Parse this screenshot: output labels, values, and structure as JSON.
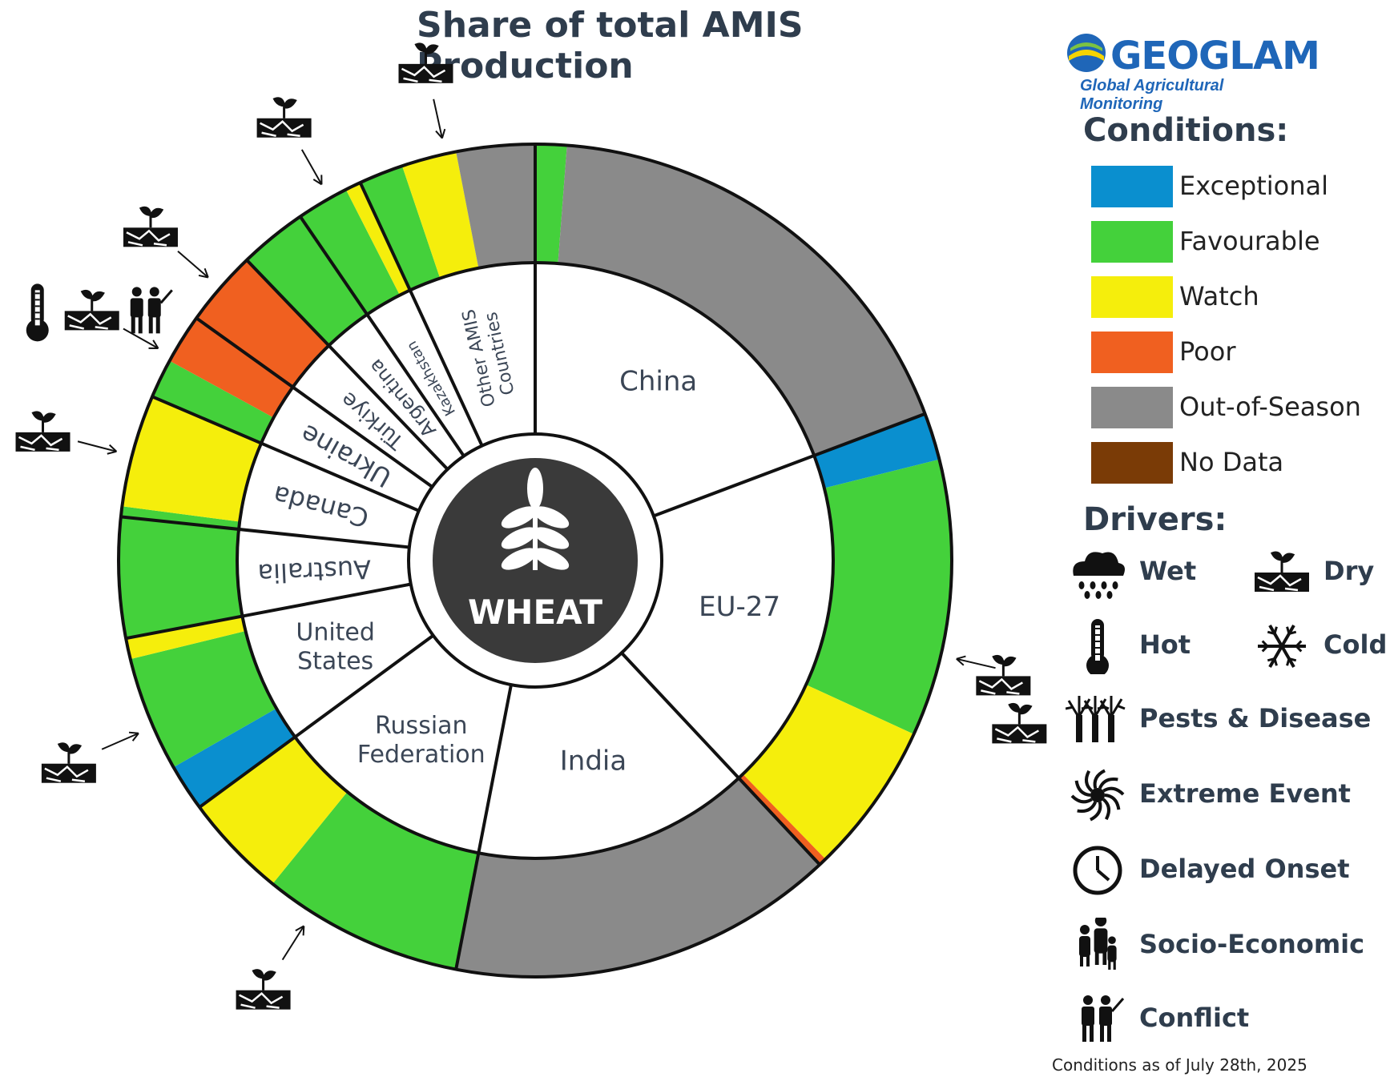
{
  "title": "Share of total AMIS Production",
  "crop": "WHEAT",
  "footnote": "Conditions as of July 28th, 2025",
  "logo": {
    "name": "GEOGLAM",
    "tagline": "Global Agricultural Monitoring"
  },
  "colors": {
    "Exceptional": "#0a8fcf",
    "Favourable": "#44d13b",
    "Watch": "#f5ee0c",
    "Poor": "#f06020",
    "Out-of-Season": "#8a8a8a",
    "No Data": "#7a3b06",
    "center": "#3a3a3a"
  },
  "legend": {
    "conditions_title": "Conditions:",
    "conditions": [
      {
        "label": "Exceptional",
        "key": "Exceptional"
      },
      {
        "label": "Favourable",
        "key": "Favourable"
      },
      {
        "label": "Watch",
        "key": "Watch"
      },
      {
        "label": "Poor",
        "key": "Poor"
      },
      {
        "label": "Out-of-Season",
        "key": "Out-of-Season"
      },
      {
        "label": "No Data",
        "key": "No Data"
      }
    ],
    "drivers_title": "Drivers:",
    "drivers": [
      {
        "label": "Wet",
        "icon": "wet-icon"
      },
      {
        "label": "Dry",
        "icon": "dry-icon"
      },
      {
        "label": "Hot",
        "icon": "hot-icon"
      },
      {
        "label": "Cold",
        "icon": "cold-icon"
      },
      {
        "label": "Pests & Disease",
        "icon": "pests-disease-icon"
      },
      {
        "label": "Extreme Event",
        "icon": "extreme-event-icon"
      },
      {
        "label": "Delayed Onset",
        "icon": "delayed-onset-icon"
      },
      {
        "label": "Socio-Economic",
        "icon": "socio-economic-icon"
      },
      {
        "label": "Conflict",
        "icon": "conflict-icon"
      }
    ]
  },
  "chart_data": {
    "type": "pie",
    "title": "Share of total AMIS Production",
    "countries": [
      {
        "label": "China",
        "share": 0.19,
        "segments": [
          {
            "condition": "Favourable",
            "share": 0.012
          },
          {
            "condition": "Out-of-Season",
            "share": 0.178
          }
        ],
        "drivers": []
      },
      {
        "label": "EU-27",
        "share": 0.185,
        "segments": [
          {
            "condition": "Exceptional",
            "share": 0.018
          },
          {
            "condition": "Favourable",
            "share": 0.106
          },
          {
            "condition": "Watch",
            "share": 0.058
          },
          {
            "condition": "Poor",
            "share": 0.003
          }
        ],
        "drivers": [
          "dry-icon",
          "dry-icon"
        ]
      },
      {
        "label": "India",
        "share": 0.148,
        "segments": [
          {
            "condition": "Out-of-Season",
            "share": 0.148
          }
        ],
        "drivers": []
      },
      {
        "label": "Russian Federation",
        "share": 0.117,
        "segments": [
          {
            "condition": "Favourable",
            "share": 0.077
          },
          {
            "condition": "Watch",
            "share": 0.04
          }
        ],
        "drivers": [
          "dry-icon"
        ]
      },
      {
        "label": "United States",
        "share": 0.07,
        "segments": [
          {
            "condition": "Exceptional",
            "share": 0.018
          },
          {
            "condition": "Favourable",
            "share": 0.044
          },
          {
            "condition": "Watch",
            "share": 0.008
          }
        ],
        "drivers": [
          "dry-icon"
        ]
      },
      {
        "label": "Australia",
        "share": 0.046,
        "segments": [
          {
            "condition": "Favourable",
            "share": 0.046
          }
        ],
        "drivers": []
      },
      {
        "label": "Canada",
        "share": 0.047,
        "segments": [
          {
            "condition": "Favourable",
            "share": 0.004
          },
          {
            "condition": "Watch",
            "share": 0.043
          }
        ],
        "drivers": [
          "dry-icon"
        ]
      },
      {
        "label": "Ukraine",
        "share": 0.034,
        "segments": [
          {
            "condition": "Favourable",
            "share": 0.015
          },
          {
            "condition": "Poor",
            "share": 0.019
          }
        ],
        "drivers": [
          "hot-icon",
          "dry-icon",
          "conflict-icon"
        ]
      },
      {
        "label": "Türkiye",
        "share": 0.029,
        "segments": [
          {
            "condition": "Poor",
            "share": 0.029
          }
        ],
        "drivers": [
          "dry-icon"
        ]
      },
      {
        "label": "Argentina",
        "share": 0.026,
        "segments": [
          {
            "condition": "Favourable",
            "share": 0.026
          }
        ],
        "drivers": []
      },
      {
        "label": "Kazakhstan",
        "share": 0.026,
        "segments": [
          {
            "condition": "Favourable",
            "share": 0.02
          },
          {
            "condition": "Watch",
            "share": 0.006
          }
        ],
        "drivers": [
          "dry-icon"
        ]
      },
      {
        "label": "Other AMIS Countries",
        "share": 0.068,
        "segments": [
          {
            "condition": "Favourable",
            "share": 0.017
          },
          {
            "condition": "Watch",
            "share": 0.021
          },
          {
            "condition": "Out-of-Season",
            "share": 0.03
          }
        ],
        "drivers": [
          "dry-icon"
        ]
      }
    ]
  }
}
